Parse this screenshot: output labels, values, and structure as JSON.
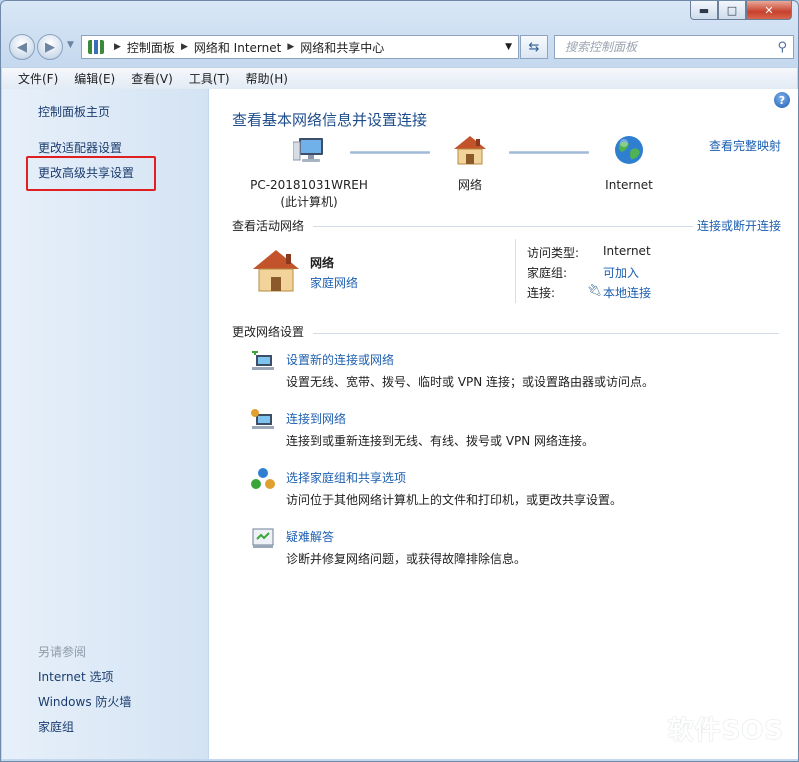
{
  "caption": {
    "minimize": "▬",
    "maximize": "□",
    "close": "✕"
  },
  "address": {
    "crumbs": [
      "控制面板",
      "网络和 Internet",
      "网络和共享中心"
    ],
    "search_placeholder": "搜索控制面板"
  },
  "menu": [
    "文件(F)",
    "编辑(E)",
    "查看(V)",
    "工具(T)",
    "帮助(H)"
  ],
  "sidebar": {
    "links": [
      "控制面板主页",
      "更改适配器设置",
      "更改高级共享设置"
    ],
    "see_also_heading": "另请参阅",
    "see_also": [
      "Internet 选项",
      "Windows 防火墙",
      "家庭组"
    ]
  },
  "main": {
    "title": "查看基本网络信息并设置连接",
    "full_map_link": "查看完整映射",
    "map": {
      "computer_name": "PC-20181031WREH",
      "computer_sub": "(此计算机)",
      "network": "网络",
      "internet": "Internet"
    },
    "active_heading": "查看活动网络",
    "connect_link": "连接或断开连接",
    "active": {
      "name": "网络",
      "type": "家庭网络",
      "access_label": "访问类型:",
      "access_value": "Internet",
      "homegroup_label": "家庭组:",
      "homegroup_value": "可加入",
      "connection_label": "连接:",
      "connection_value": "本地连接"
    },
    "change_heading": "更改网络设置",
    "tasks": [
      {
        "title": "设置新的连接或网络",
        "desc": "设置无线、宽带、拨号、临时或 VPN 连接；或设置路由器或访问点。",
        "icon": "new-connection-icon"
      },
      {
        "title": "连接到网络",
        "desc": "连接到或重新连接到无线、有线、拨号或 VPN 网络连接。",
        "icon": "connect-network-icon"
      },
      {
        "title": "选择家庭组和共享选项",
        "desc": "访问位于其他网络计算机上的文件和打印机，或更改共享设置。",
        "icon": "homegroup-icon"
      },
      {
        "title": "疑难解答",
        "desc": "诊断并修复网络问题，或获得故障排除信息。",
        "icon": "troubleshoot-icon"
      }
    ]
  },
  "watermark": "软件SOS",
  "colors": {
    "link": "#1d5fb0",
    "title": "#1e4d8c",
    "highlight": "#e02020"
  }
}
